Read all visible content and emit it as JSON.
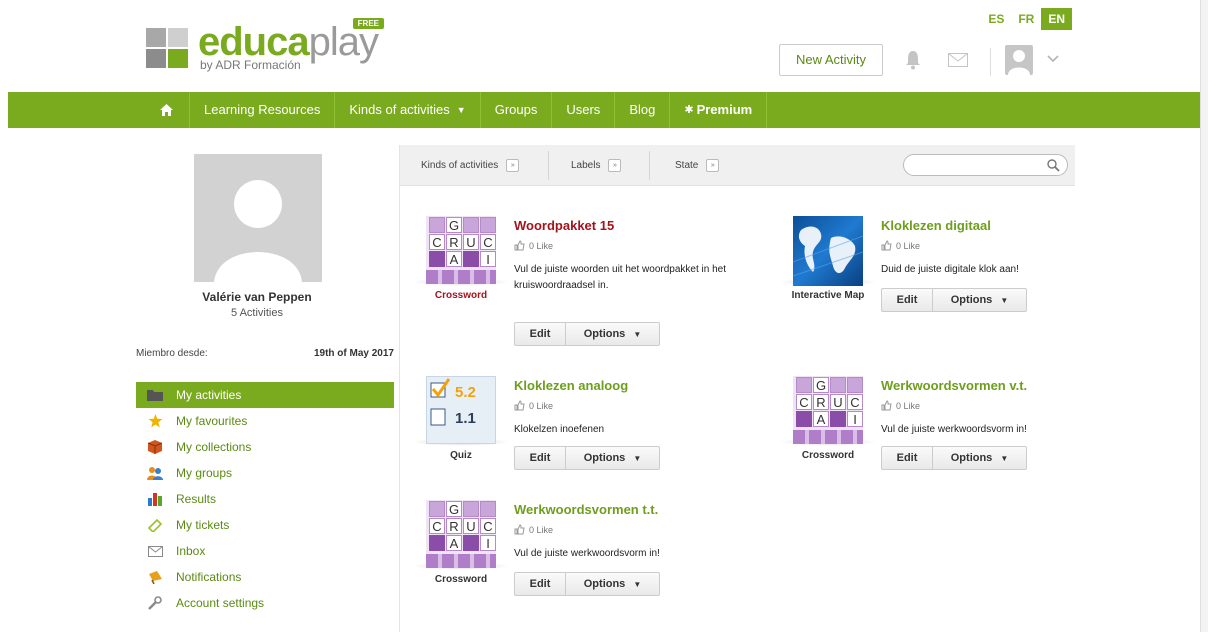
{
  "header": {
    "languages": [
      {
        "code": "ES",
        "active": false
      },
      {
        "code": "FR",
        "active": false
      },
      {
        "code": "EN",
        "active": true
      }
    ],
    "logo": {
      "educa": "educa",
      "play": "play",
      "sub": "by ADR Formación",
      "badge": "FREE"
    },
    "new_activity_label": "New Activity",
    "icons": [
      "bell-icon",
      "mail-icon",
      "user-avatar",
      "chevron-down-icon"
    ]
  },
  "nav": {
    "items": [
      {
        "label": "Learning Resources"
      },
      {
        "label": "Kinds of activities",
        "dropdown": true
      },
      {
        "label": "Groups"
      },
      {
        "label": "Users"
      },
      {
        "label": "Blog"
      },
      {
        "label": "Premium",
        "prefix": "✱"
      }
    ],
    "accent": "#7aab1f"
  },
  "profile": {
    "name": "Valérie van Peppen",
    "activities": "5 Activities",
    "member_label": "Miembro desde:",
    "member_date": "19th of May 2017"
  },
  "sidebar": {
    "items": [
      {
        "label": "My activities",
        "icon": "folder-icon",
        "active": true
      },
      {
        "label": "My favourites",
        "icon": "star-icon"
      },
      {
        "label": "My collections",
        "icon": "box-icon"
      },
      {
        "label": "My groups",
        "icon": "group-icon"
      },
      {
        "label": "Results",
        "icon": "bar-chart-icon"
      },
      {
        "label": "My tickets",
        "icon": "ticket-icon"
      },
      {
        "label": "Inbox",
        "icon": "envelope-icon"
      },
      {
        "label": "Notifications",
        "icon": "megaphone-icon"
      },
      {
        "label": "Account settings",
        "icon": "wrench-icon"
      }
    ]
  },
  "filters": {
    "kinds": "Kinds of activities",
    "labels": "Labels",
    "state": "State",
    "search_placeholder": ""
  },
  "activities": [
    {
      "title": "Woordpakket 15",
      "title_color": "#a2141c",
      "likes": "0 Like",
      "type": "Crossword",
      "type_color": "#a2141c",
      "description": "Vul de juiste woorden uit het woordpakket in het kruiswoordraadsel in.",
      "edit": "Edit",
      "options": "Options"
    },
    {
      "title": "Kloklezen digitaal",
      "title_color": "#6d9e1c",
      "likes": "0 Like",
      "type": "Interactive Map",
      "type_color": "#444444",
      "description": "Duid de juiste digitale klok aan!",
      "edit": "Edit",
      "options": "Options"
    },
    {
      "title": "Kloklezen analoog",
      "title_color": "#6d9e1c",
      "likes": "0 Like",
      "type": "Quiz",
      "type_color": "#444444",
      "description": "Klokelzen inoefenen",
      "edit": "Edit",
      "options": "Options",
      "thumb_text": {
        "a": "5.2",
        "b": "1.1"
      }
    },
    {
      "title": "Werkwoordsvormen v.t.",
      "title_color": "#6d9e1c",
      "likes": "0 Like",
      "type": "Crossword",
      "type_color": "#444444",
      "description": "Vul de juiste werkwoordsvorm in!",
      "edit": "Edit",
      "options": "Options"
    },
    {
      "title": "Werkwoordsvormen t.t.",
      "title_color": "#6d9e1c",
      "likes": "0 Like",
      "type": "Crossword",
      "type_color": "#444444",
      "description": "Vul de juiste werkwoordsvorm in!",
      "edit": "Edit",
      "options": "Options"
    }
  ],
  "crossword_letters": [
    "G",
    "C",
    "R",
    "U",
    "C",
    "A",
    "I"
  ]
}
